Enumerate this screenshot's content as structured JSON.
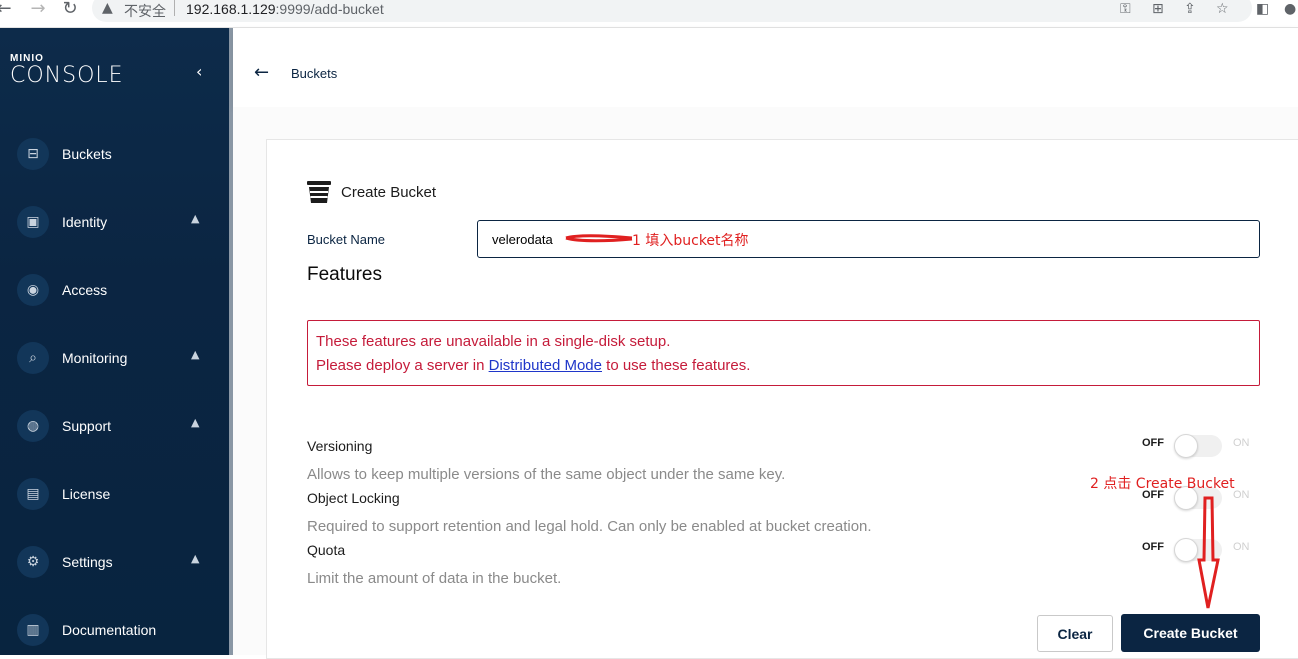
{
  "browser": {
    "security_label": "不安全",
    "url_host": "192.168.1.129",
    "url_rest": ":9999/add-bucket"
  },
  "sidebar": {
    "logo_small": "MINIO",
    "logo_large": "CONSOLE",
    "items": [
      {
        "label": "Buckets",
        "icon": "bucket-icon",
        "expandable": false
      },
      {
        "label": "Identity",
        "icon": "id-card-icon",
        "expandable": true
      },
      {
        "label": "Access",
        "icon": "lock-icon",
        "expandable": false
      },
      {
        "label": "Monitoring",
        "icon": "magnifier-icon",
        "expandable": true
      },
      {
        "label": "Support",
        "icon": "lifebuoy-icon",
        "expandable": true
      },
      {
        "label": "License",
        "icon": "certificate-icon",
        "expandable": false
      },
      {
        "label": "Settings",
        "icon": "gear-icon",
        "expandable": true
      },
      {
        "label": "Documentation",
        "icon": "document-icon",
        "expandable": false
      }
    ]
  },
  "header": {
    "breadcrumb": "Buckets"
  },
  "form": {
    "title": "Create Bucket",
    "bucket_name_label": "Bucket Name",
    "bucket_name_value": "velerodata",
    "features_heading": "Features",
    "warning_line1": "These features are unavailable in a single-disk setup.",
    "warning_line2_pre": "Please deploy a server in ",
    "warning_line2_link": "Distributed Mode",
    "warning_line2_post": " to use these features.",
    "features": [
      {
        "title": "Versioning",
        "description": "Allows to keep multiple versions of the same object under the same key.",
        "off_label": "OFF",
        "on_label": "ON",
        "enabled": false
      },
      {
        "title": "Object Locking",
        "description": "Required to support retention and legal hold. Can only be enabled at bucket creation.",
        "off_label": "OFF",
        "on_label": "ON",
        "enabled": false
      },
      {
        "title": "Quota",
        "description": "Limit the amount of data in the bucket.",
        "off_label": "OFF",
        "on_label": "ON",
        "enabled": false
      }
    ],
    "clear_label": "Clear",
    "create_label": "Create Bucket"
  },
  "annotations": {
    "step1": "1 填入bucket名称",
    "step2": "2 点击 Create Bucket",
    "color": "#e02020"
  },
  "colors": {
    "sidebar": "#0b2542",
    "primary": "#0b2542",
    "error": "#c51b3a",
    "link": "#1f36c9"
  }
}
